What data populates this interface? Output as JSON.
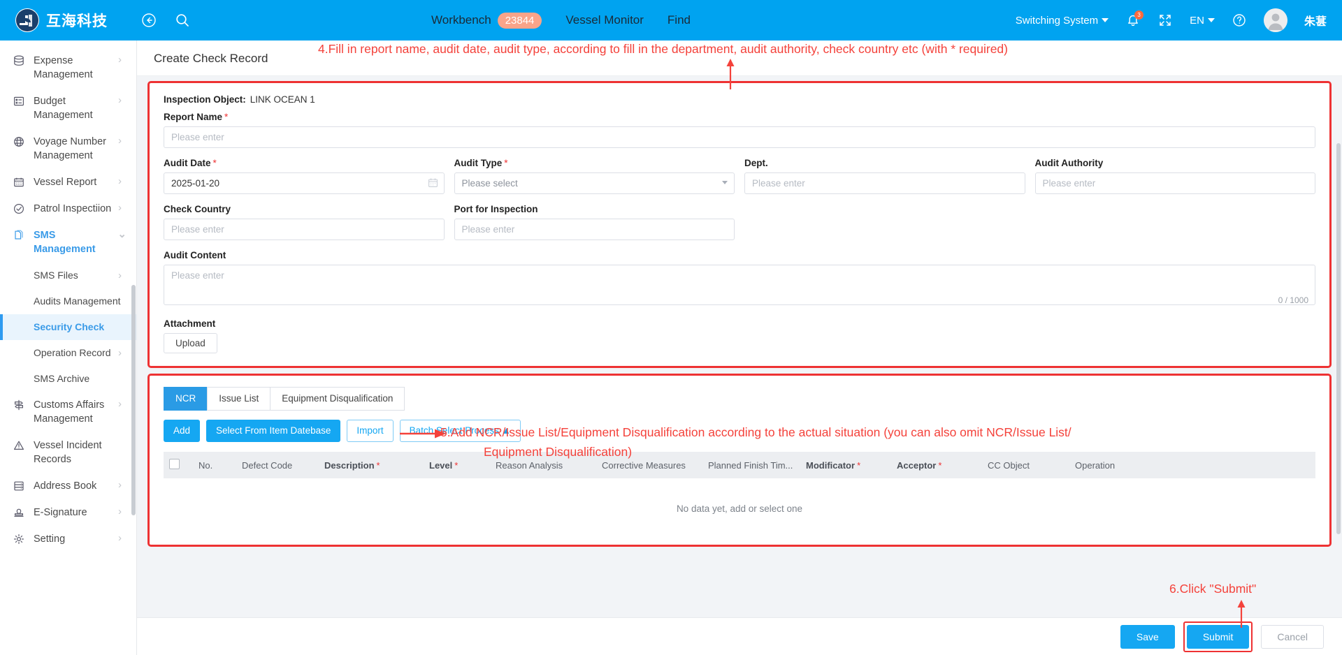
{
  "topbar": {
    "brand_name": "互海科技",
    "back_icon": "back-arrow-icon",
    "search_icon": "search-icon",
    "workbench_label": "Workbench",
    "workbench_count": "23844",
    "vessel_monitor_label": "Vessel Monitor",
    "find_label": "Find",
    "switching_system_label": "Switching System",
    "bell_badge": "3",
    "language_label": "EN",
    "user_name": "朱葚"
  },
  "sidebar": {
    "items": [
      {
        "label": "Expense Management",
        "icon": "database-icon",
        "chevron": "›",
        "type": "parent"
      },
      {
        "label": "Budget Management",
        "icon": "budget-icon",
        "chevron": "›",
        "type": "parent"
      },
      {
        "label": "Voyage Number Management",
        "icon": "globe-icon",
        "chevron": "›",
        "type": "parent"
      },
      {
        "label": "Vessel Report",
        "icon": "calendar-icon",
        "chevron": "›",
        "type": "parent"
      },
      {
        "label": "Patrol Inspectiion",
        "icon": "check-circle-icon",
        "chevron": "›",
        "type": "parent"
      },
      {
        "label": "SMS Management",
        "icon": "documents-icon",
        "chevron": "⌄",
        "type": "parent-active"
      },
      {
        "label": "SMS Files",
        "chevron": "›",
        "type": "sub"
      },
      {
        "label": "Audits Management",
        "chevron": "",
        "type": "sub"
      },
      {
        "label": "Security Check",
        "chevron": "",
        "type": "sub-selected"
      },
      {
        "label": "Operation Record",
        "chevron": "›",
        "type": "sub"
      },
      {
        "label": "SMS Archive",
        "chevron": "",
        "type": "sub"
      },
      {
        "label": "Customs Affairs Management",
        "icon": "signpost-icon",
        "chevron": "›",
        "type": "parent"
      },
      {
        "label": "Vessel Incident Records",
        "icon": "warning-icon",
        "chevron": "",
        "type": "parent"
      },
      {
        "label": "Address Book",
        "icon": "address-book-icon",
        "chevron": "›",
        "type": "parent"
      },
      {
        "label": "E-Signature",
        "icon": "stamp-icon",
        "chevron": "›",
        "type": "parent"
      },
      {
        "label": "Setting",
        "icon": "gear-icon",
        "chevron": "›",
        "type": "parent"
      }
    ]
  },
  "page": {
    "title": "Create Check Record"
  },
  "form": {
    "inspection_object_label": "Inspection Object:",
    "inspection_object_value": "LINK OCEAN 1",
    "report_name_label": "Report Name",
    "report_name_placeholder": "Please enter",
    "report_name_value": "",
    "audit_date_label": "Audit Date",
    "audit_date_value": "2025-01-20",
    "audit_type_label": "Audit Type",
    "audit_type_value": "Please select",
    "dept_label": "Dept.",
    "dept_placeholder": "Please enter",
    "audit_authority_label": "Audit Authority",
    "audit_authority_placeholder": "Please enter",
    "check_country_label": "Check Country",
    "check_country_placeholder": "Please enter",
    "port_label": "Port for Inspection",
    "port_placeholder": "Please enter",
    "audit_content_label": "Audit Content",
    "audit_content_placeholder": "Please enter",
    "audit_content_counter": "0 / 1000",
    "attachment_label": "Attachment",
    "upload_label": "Upload"
  },
  "records": {
    "tabs": [
      {
        "label": "NCR",
        "active": true
      },
      {
        "label": "Issue List",
        "active": false
      },
      {
        "label": "Equipment Disqualification",
        "active": false
      }
    ],
    "buttons": [
      {
        "label": "Add",
        "style": "primary"
      },
      {
        "label": "Select From Item Datebase",
        "style": "primary"
      },
      {
        "label": "Import",
        "style": "outline"
      },
      {
        "label": "Batch Select Process ▲",
        "style": "outline"
      }
    ],
    "columns": [
      {
        "label": "No.",
        "required": false
      },
      {
        "label": "Defect Code",
        "required": false
      },
      {
        "label": "Description",
        "required": true
      },
      {
        "label": "Level",
        "required": true
      },
      {
        "label": "Reason Analysis",
        "required": false
      },
      {
        "label": "Corrective Measures",
        "required": false
      },
      {
        "label": "Planned Finish Tim...",
        "required": false
      },
      {
        "label": "Modificator",
        "required": true
      },
      {
        "label": "Acceptor",
        "required": true
      },
      {
        "label": "CC Object",
        "required": false
      },
      {
        "label": "Operation",
        "required": false
      }
    ],
    "empty_text": "No data yet, add or select one"
  },
  "footer": {
    "save_label": "Save",
    "submit_label": "Submit",
    "cancel_label": "Cancel"
  },
  "annotations": {
    "step4": "4.Fill in report name, audit date, audit type, according to fill in the department, audit authority, check country etc (with * required)",
    "step5_line1": "5.Add NCR/Issue List/Equipment Disqualification according to the actual situation (you can also omit NCR/Issue List/",
    "step5_line2": "Equipment Disqualification)",
    "step6": "6.Click \"Submit\"",
    "color": "#F4423B"
  }
}
